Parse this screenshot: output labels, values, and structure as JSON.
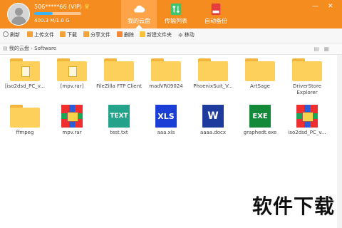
{
  "user": {
    "name": "506*****66 (VIP)",
    "quota_text": "400.3 M/1.0 G",
    "quota_fraction": 0.4
  },
  "tabs": [
    {
      "label": "我的云盘",
      "icon": "cloud-icon",
      "active": true
    },
    {
      "label": "传输列表",
      "icon": "transfer-icon",
      "active": false
    },
    {
      "label": "自动备份",
      "icon": "backup-icon",
      "active": false
    }
  ],
  "toolbar": {
    "refresh": "刷新",
    "upload": "上传文件",
    "download": "下载",
    "share": "分享文件",
    "delete": "删除",
    "new_folder": "新建文件夹",
    "move": "移动"
  },
  "breadcrumb": {
    "root": "我的云盘",
    "current": "Software"
  },
  "files": [
    {
      "name": "[iso2dsd_PC_v...",
      "type": "folder"
    },
    {
      "name": "[mpv.rar]",
      "type": "folder"
    },
    {
      "name": "FileZilla FTP Client",
      "type": "folder"
    },
    {
      "name": "madVR09024",
      "type": "folder"
    },
    {
      "name": "PhoenixSuit_V...",
      "type": "folder"
    },
    {
      "name": "ArtSage",
      "type": "folder"
    },
    {
      "name": "DriverStore Explorer",
      "type": "folder"
    },
    {
      "name": "ffmpeg",
      "type": "folder"
    },
    {
      "name": "mpv.rar",
      "type": "rar"
    },
    {
      "name": "test.txt",
      "type": "txt",
      "badge": "TEXT"
    },
    {
      "name": "aaa.xls",
      "type": "xls",
      "badge": "XLS"
    },
    {
      "name": "aaaa.docx",
      "type": "docx",
      "badge": "W"
    },
    {
      "name": "graphedt.exe",
      "type": "exe",
      "badge": "EXE"
    },
    {
      "name": "iso2dsd_PC_v...",
      "type": "rar"
    }
  ],
  "watermark": "软件下载"
}
